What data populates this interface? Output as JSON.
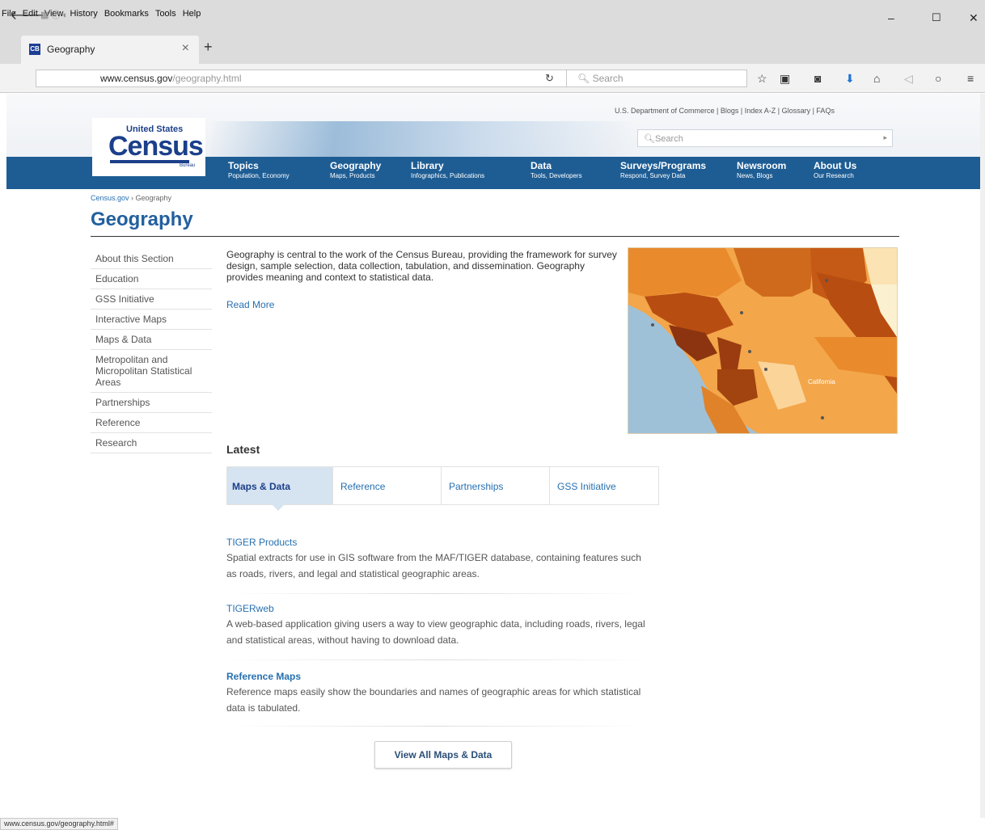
{
  "browser": {
    "menu": [
      "File",
      "Edit",
      "View",
      "History",
      "Bookmarks",
      "Tools",
      "Help"
    ],
    "tab_title": "Geography",
    "tab_favicon": "CB",
    "url_domain": "www.census.gov",
    "url_path": "/geography.html",
    "search_placeholder": "Search",
    "status_url": "www.census.gov/geography.html#"
  },
  "header": {
    "logo_top": "United States",
    "logo_main": "Census",
    "logo_bottom": "Bureau",
    "utility_links": "U.S. Department of Commerce | Blogs | Index A-Z | Glossary | FAQs",
    "search_placeholder": "Search"
  },
  "nav": [
    {
      "title": "Topics",
      "sub": "Population, Economy"
    },
    {
      "title": "Geography",
      "sub": "Maps, Products"
    },
    {
      "title": "Library",
      "sub": "Infographics, Publications"
    },
    {
      "title": "Data",
      "sub": "Tools, Developers"
    },
    {
      "title": "Surveys/Programs",
      "sub": "Respond, Survey Data"
    },
    {
      "title": "Newsroom",
      "sub": "News, Blogs"
    },
    {
      "title": "About Us",
      "sub": "Our Research"
    }
  ],
  "breadcrumb": {
    "home": "Census.gov",
    "sep": " › ",
    "current": "Geography"
  },
  "page_title": "Geography",
  "left_nav": [
    "About this Section",
    "Education",
    "GSS Initiative",
    "Interactive Maps",
    "Maps & Data",
    "Metropolitan and Micropolitan Statistical Areas",
    "Partnerships",
    "Reference",
    "Research"
  ],
  "intro": "Geography is central to the work of the Census Bureau, providing the framework for survey design, sample selection, data collection, tabulation, and dissemination.  Geography provides meaning and context to statistical data.",
  "read_more": "Read More",
  "map_label": "California",
  "latest": {
    "heading": "Latest",
    "tabs": [
      "Maps & Data",
      "Reference",
      "Partnerships",
      "GSS Initiative"
    ],
    "items": [
      {
        "title": "TIGER Products",
        "desc": "Spatial extracts for use in GIS software from the MAF/TIGER database, containing features such as roads, rivers, and legal and statistical geographic areas."
      },
      {
        "title": "TIGERweb",
        "desc": "A web-based application giving users a way to view geographic data, including roads, rivers, legal and statistical areas, without having to download data."
      },
      {
        "title": "Reference Maps",
        "desc": "Reference maps easily show the boundaries and names of geographic areas for which statistical data is tabulated."
      }
    ],
    "view_all": "View All Maps & Data"
  }
}
